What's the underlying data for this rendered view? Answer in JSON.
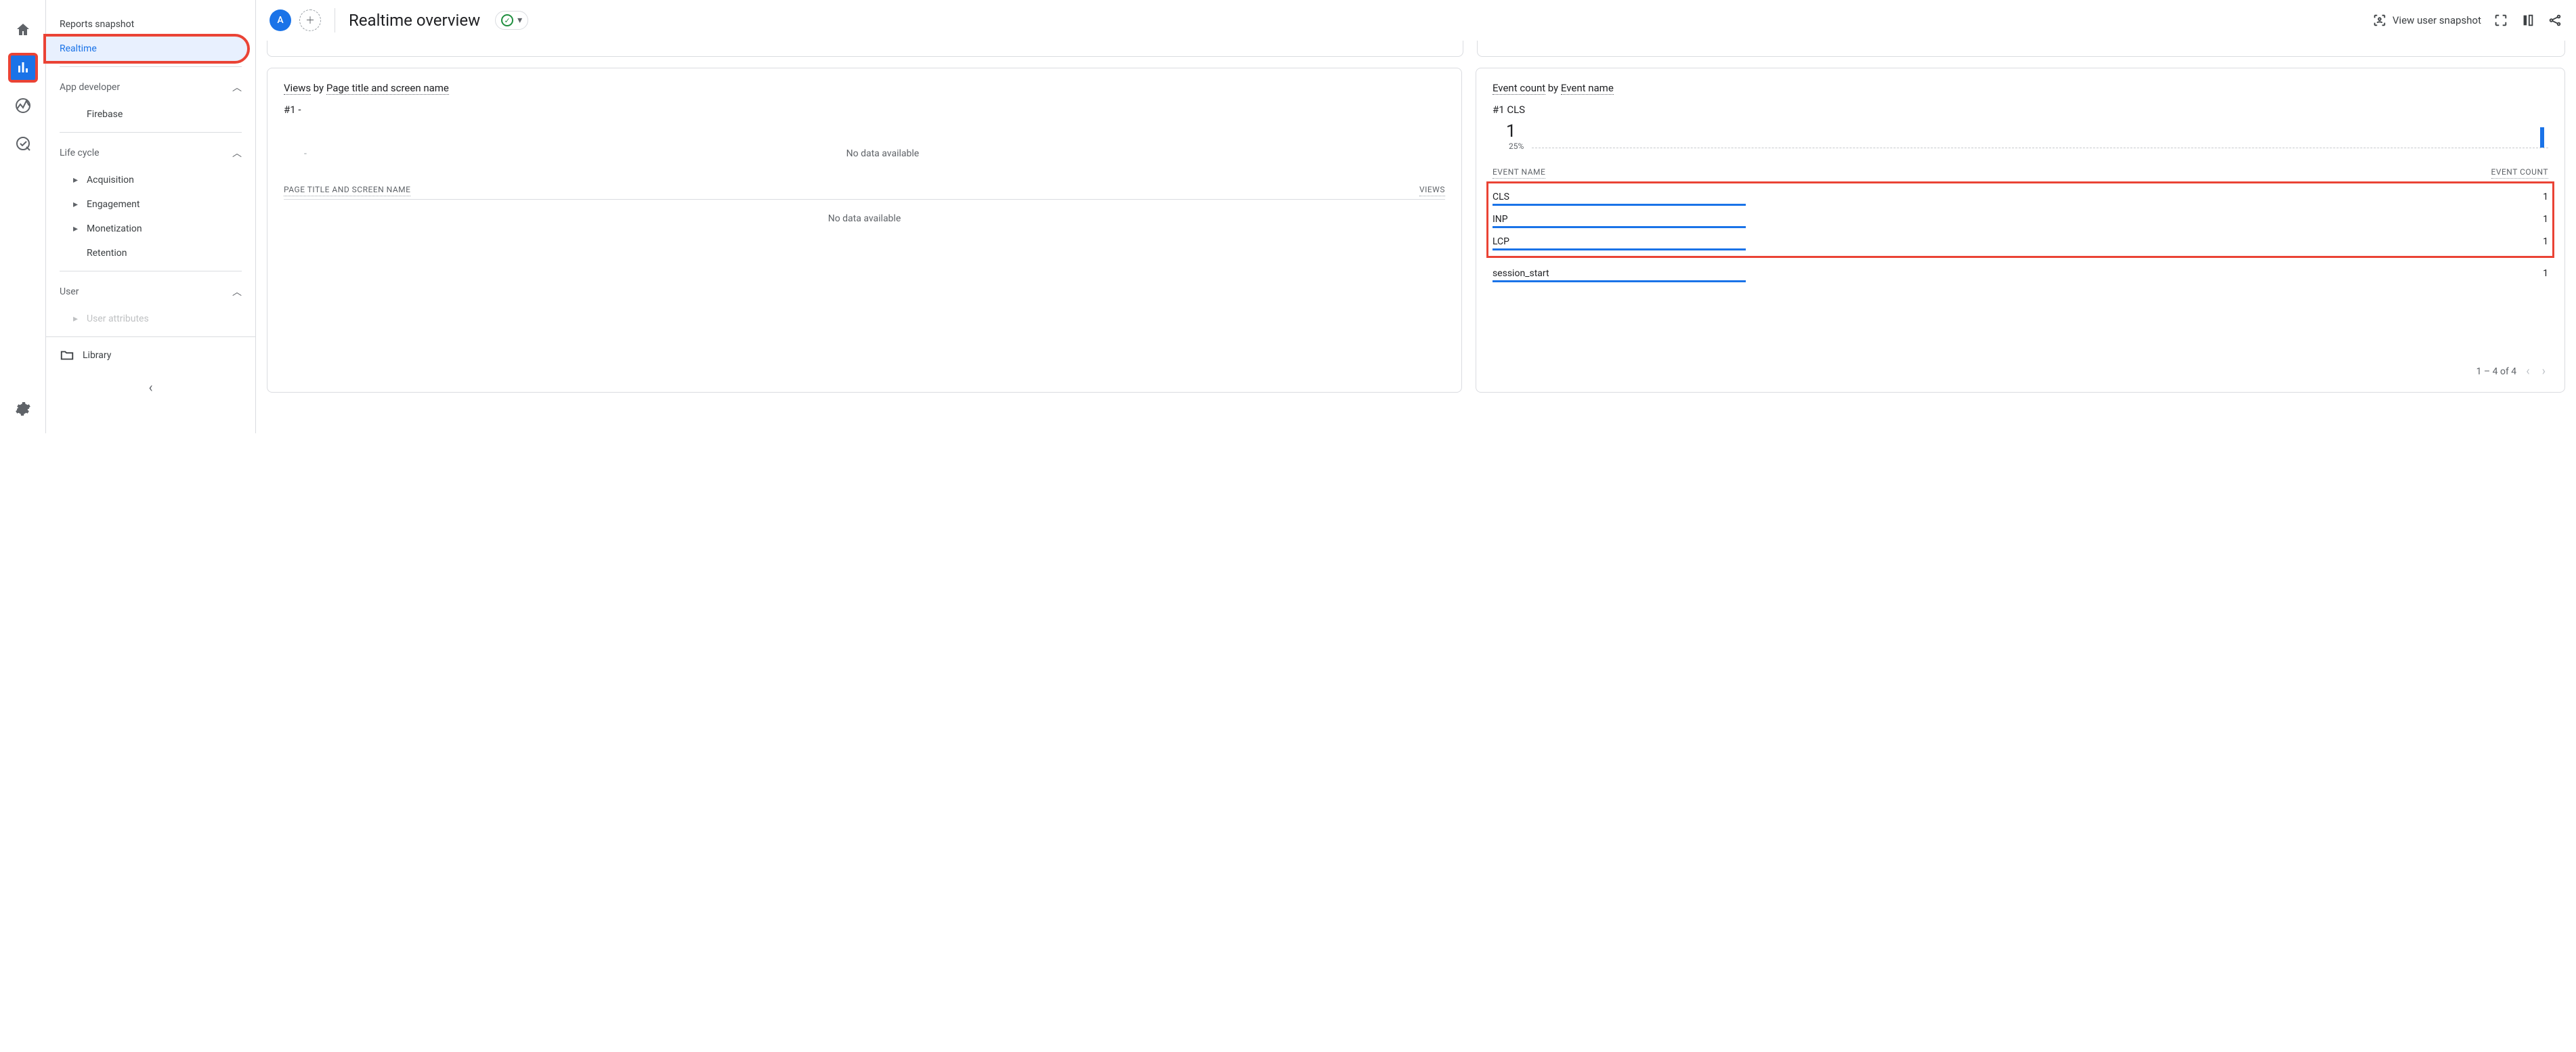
{
  "rail": {
    "home": "home-icon",
    "reports": "reports-icon",
    "explore": "explore-icon",
    "ads": "ads-icon",
    "admin": "admin-icon"
  },
  "sidebar": {
    "reports_snapshot": "Reports snapshot",
    "realtime": "Realtime",
    "groups": {
      "app_dev": {
        "label": "App developer",
        "items": [
          "Firebase"
        ]
      },
      "life_cycle": {
        "label": "Life cycle",
        "items": [
          "Acquisition",
          "Engagement",
          "Monetization",
          "Retention"
        ]
      },
      "user": {
        "label": "User",
        "items_cut": "User attributes"
      }
    },
    "library": "Library"
  },
  "header": {
    "segment_a": "A",
    "title": "Realtime overview",
    "view_snapshot": "View user snapshot"
  },
  "views_card": {
    "title_prefix": "Views",
    "title_by": " by ",
    "title_dim": "Page title and screen name",
    "rank": "#1  -",
    "no_data_top": "No data available",
    "col_left": "PAGE TITLE AND SCREEN NAME",
    "col_right": "VIEWS",
    "no_data_body": "No data available"
  },
  "events_card": {
    "title_prefix": "Event count",
    "title_by": " by ",
    "title_dim": "Event name",
    "rank": "#1  CLS",
    "big_value": "1",
    "pct": "25%",
    "col_left": "EVENT NAME",
    "col_right": "EVENT COUNT",
    "rows": [
      {
        "name": "CLS",
        "count": "1",
        "bar": 24
      },
      {
        "name": "INP",
        "count": "1",
        "bar": 24
      },
      {
        "name": "LCP",
        "count": "1",
        "bar": 24
      },
      {
        "name": "session_start",
        "count": "1",
        "bar": 24
      }
    ],
    "pager": "1 – 4 of 4"
  },
  "chart_data": {
    "type": "bar",
    "title": "Event count by Event name",
    "categories": [
      "CLS",
      "INP",
      "LCP",
      "session_start"
    ],
    "values": [
      1,
      1,
      1,
      1
    ],
    "xlabel": "Event name",
    "ylabel": "Event count",
    "top_event": {
      "name": "CLS",
      "count": 1,
      "share_pct": 25
    }
  }
}
